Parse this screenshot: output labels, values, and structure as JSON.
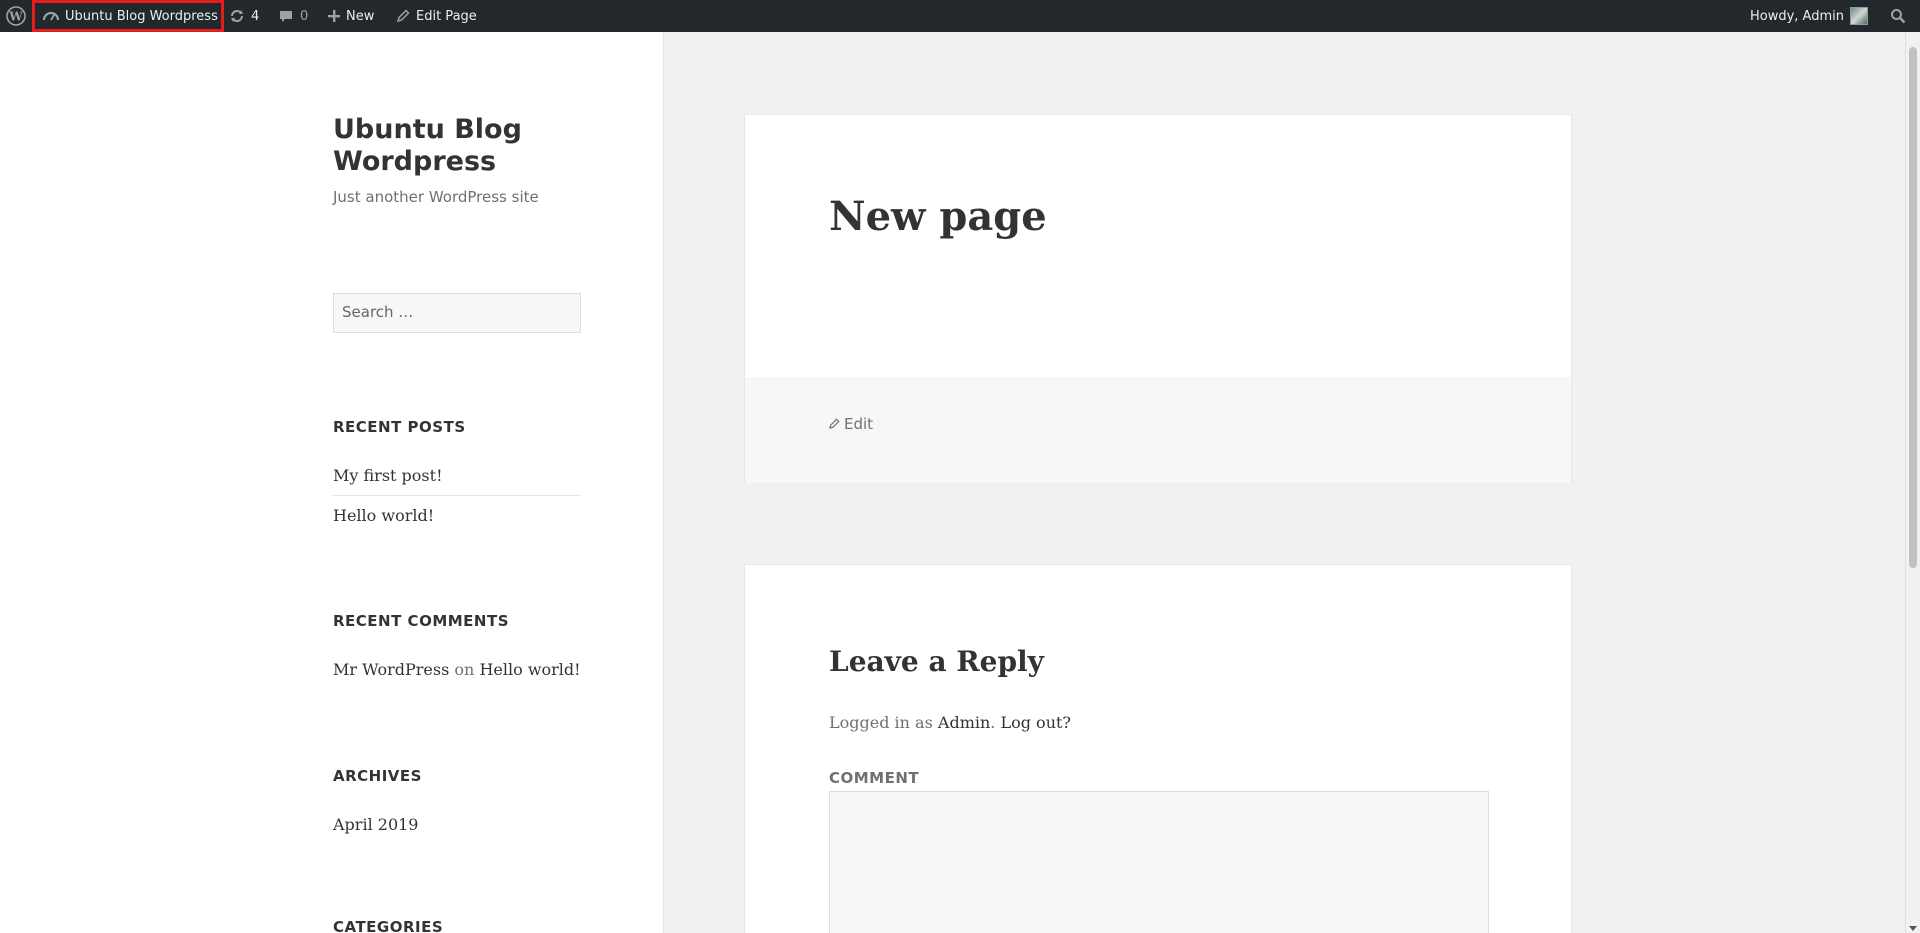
{
  "adminbar": {
    "site_name": "Ubuntu Blog Wordpress",
    "updates_count": "4",
    "comments_count": "0",
    "new_label": "New",
    "edit_label": "Edit Page",
    "howdy": "Howdy, Admin"
  },
  "sidebar": {
    "site_title": "Ubuntu Blog Wordpress",
    "site_description": "Just another WordPress site",
    "search_placeholder": "Search …",
    "recent_posts_title": "RECENT POSTS",
    "recent_posts": [
      "My first post!",
      "Hello world!"
    ],
    "recent_comments_title": "RECENT COMMENTS",
    "recent_comment": {
      "author": "Mr WordPress",
      "on": "on",
      "post": "Hello world!"
    },
    "archives_title": "ARCHIVES",
    "archives": [
      "April 2019"
    ],
    "categories_title": "CATEGORIES"
  },
  "article": {
    "title": "New page",
    "edit_link": "Edit"
  },
  "comments": {
    "reply_title": "Leave a Reply",
    "logged_in_prefix": "Logged in as",
    "user": "Admin",
    "logout": "Log out?",
    "comment_label": "COMMENT"
  }
}
